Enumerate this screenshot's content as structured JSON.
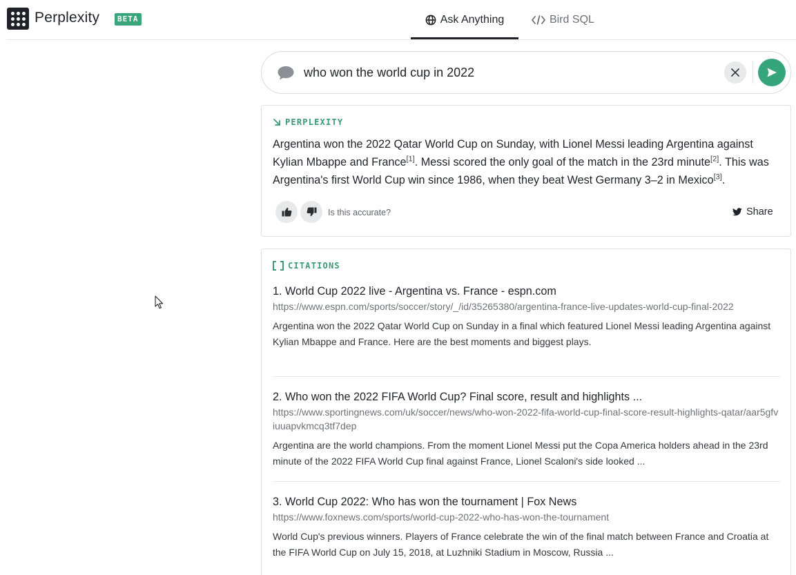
{
  "app": {
    "brand": "Perplexity",
    "badge": "BETA"
  },
  "tabs": [
    {
      "label": "Ask Anything",
      "icon": "globe-icon",
      "active": true
    },
    {
      "label": "Bird SQL",
      "icon": "code-icon",
      "active": false
    }
  ],
  "search": {
    "query": "who won the world cup in 2022"
  },
  "answer": {
    "label": "PERPLEXITY",
    "parts": [
      "Argentina won the 2022 Qatar World Cup on Sunday, with Lionel Messi leading Argentina against Kylian Mbappe and France",
      "[1]",
      ". Messi scored the only goal of the match in the 23rd minute",
      "[2]",
      ". This was Argentina's first World Cup win since 1986, when they beat West Germany 3–2 in Mexico",
      "[3]",
      "."
    ],
    "feedback_prompt": "Is this accurate?",
    "share_label": "Share"
  },
  "citations": {
    "label": "CITATIONS",
    "items": [
      {
        "title": "1. World Cup 2022 live - Argentina vs. France - espn.com",
        "url": "https://www.espn.com/sports/soccer/story/_/id/35265380/argentina-france-live-updates-world-cup-final-2022",
        "snippet": "Argentina won the 2022 Qatar World Cup on Sunday in a final which featured Lionel Messi leading Argentina against Kylian Mbappe and France. Here are the best moments and biggest plays."
      },
      {
        "title": "2. Who won the 2022 FIFA World Cup? Final score, result and highlights ...",
        "url": "https://www.sportingnews.com/uk/soccer/news/who-won-2022-fifa-world-cup-final-score-result-highlights-qatar/aar5gfviuuapvkmcq3tf7dep",
        "snippet": "Argentina are the world champions. From the moment Lionel Messi put the Copa America holders ahead in the 23rd minute of the 2022 FIFA World Cup final against France, Lionel Scaloni's side looked ..."
      },
      {
        "title": "3. World Cup 2022: Who has won the tournament | Fox News",
        "url": "https://www.foxnews.com/sports/world-cup-2022-who-has-won-the-tournament",
        "snippet": "World Cup's previous winners. Players of France celebrate the win of the final match between France and Croatia at the FIFA World Cup on July 15, 2018, at Luzhniki Stadium in Moscow, Russia ..."
      }
    ]
  },
  "colors": {
    "accent": "#36a57b",
    "label_green": "#3a9a73",
    "text": "#1f2329",
    "muted": "#6d7278"
  }
}
